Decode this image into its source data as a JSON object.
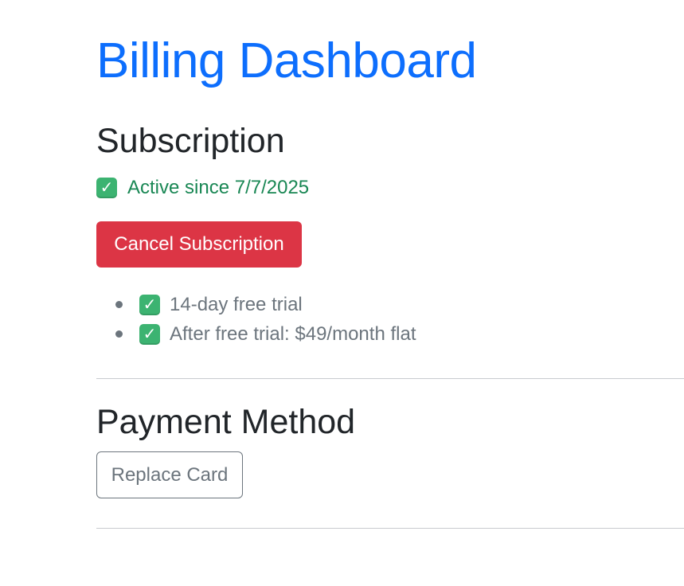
{
  "page": {
    "title": "Billing Dashboard"
  },
  "subscription": {
    "heading": "Subscription",
    "status_icon": "check-mark-button-icon",
    "status_text": "Active since 7/7/2025",
    "status_color": "#198754",
    "cancel_label": "Cancel Subscription",
    "cancel_color": "#dc3545",
    "features": [
      {
        "icon": "check-mark-button-icon",
        "text": "14-day free trial"
      },
      {
        "icon": "check-mark-button-icon",
        "text": "After free trial: $49/month flat"
      }
    ]
  },
  "payment": {
    "heading": "Payment Method",
    "replace_label": "Replace Card"
  },
  "colors": {
    "title": "#0d6efd",
    "heading": "#212529",
    "muted": "#6c757d"
  }
}
